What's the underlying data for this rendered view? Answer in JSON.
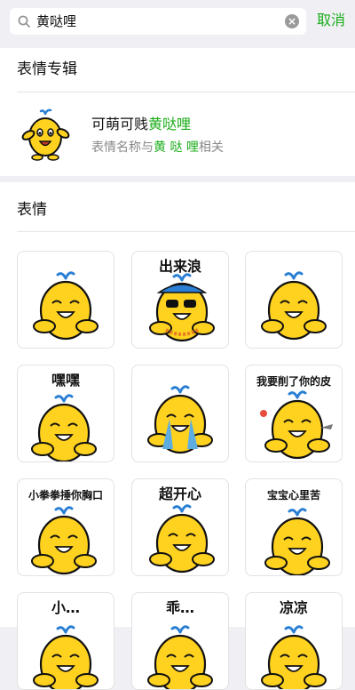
{
  "search": {
    "query": "黄哒哩",
    "clear_icon": "clear-icon",
    "cancel_label": "取消"
  },
  "albums_section": {
    "title": "表情专辑",
    "album": {
      "name_prefix": "可萌可贱",
      "name_highlight": "黄哒哩",
      "desc_prefix": "表情名称与",
      "desc_highlight": "黄 哒 哩",
      "desc_suffix": "相关"
    }
  },
  "stickers_section": {
    "title": "表情",
    "stickers": [
      {
        "caption": ""
      },
      {
        "caption": "出来浪"
      },
      {
        "caption": ""
      },
      {
        "caption": "嘿嘿"
      },
      {
        "caption": ""
      },
      {
        "caption": "我要削了你的皮"
      },
      {
        "caption": "小拳拳捶你胸口"
      },
      {
        "caption": "超开心"
      },
      {
        "caption": "宝宝心里苦"
      },
      {
        "caption": "小…"
      },
      {
        "caption": "乖…"
      },
      {
        "caption": "凉凉"
      }
    ]
  },
  "colors": {
    "accent": "#1aad19",
    "sticker_yellow": "#ffd21f"
  }
}
